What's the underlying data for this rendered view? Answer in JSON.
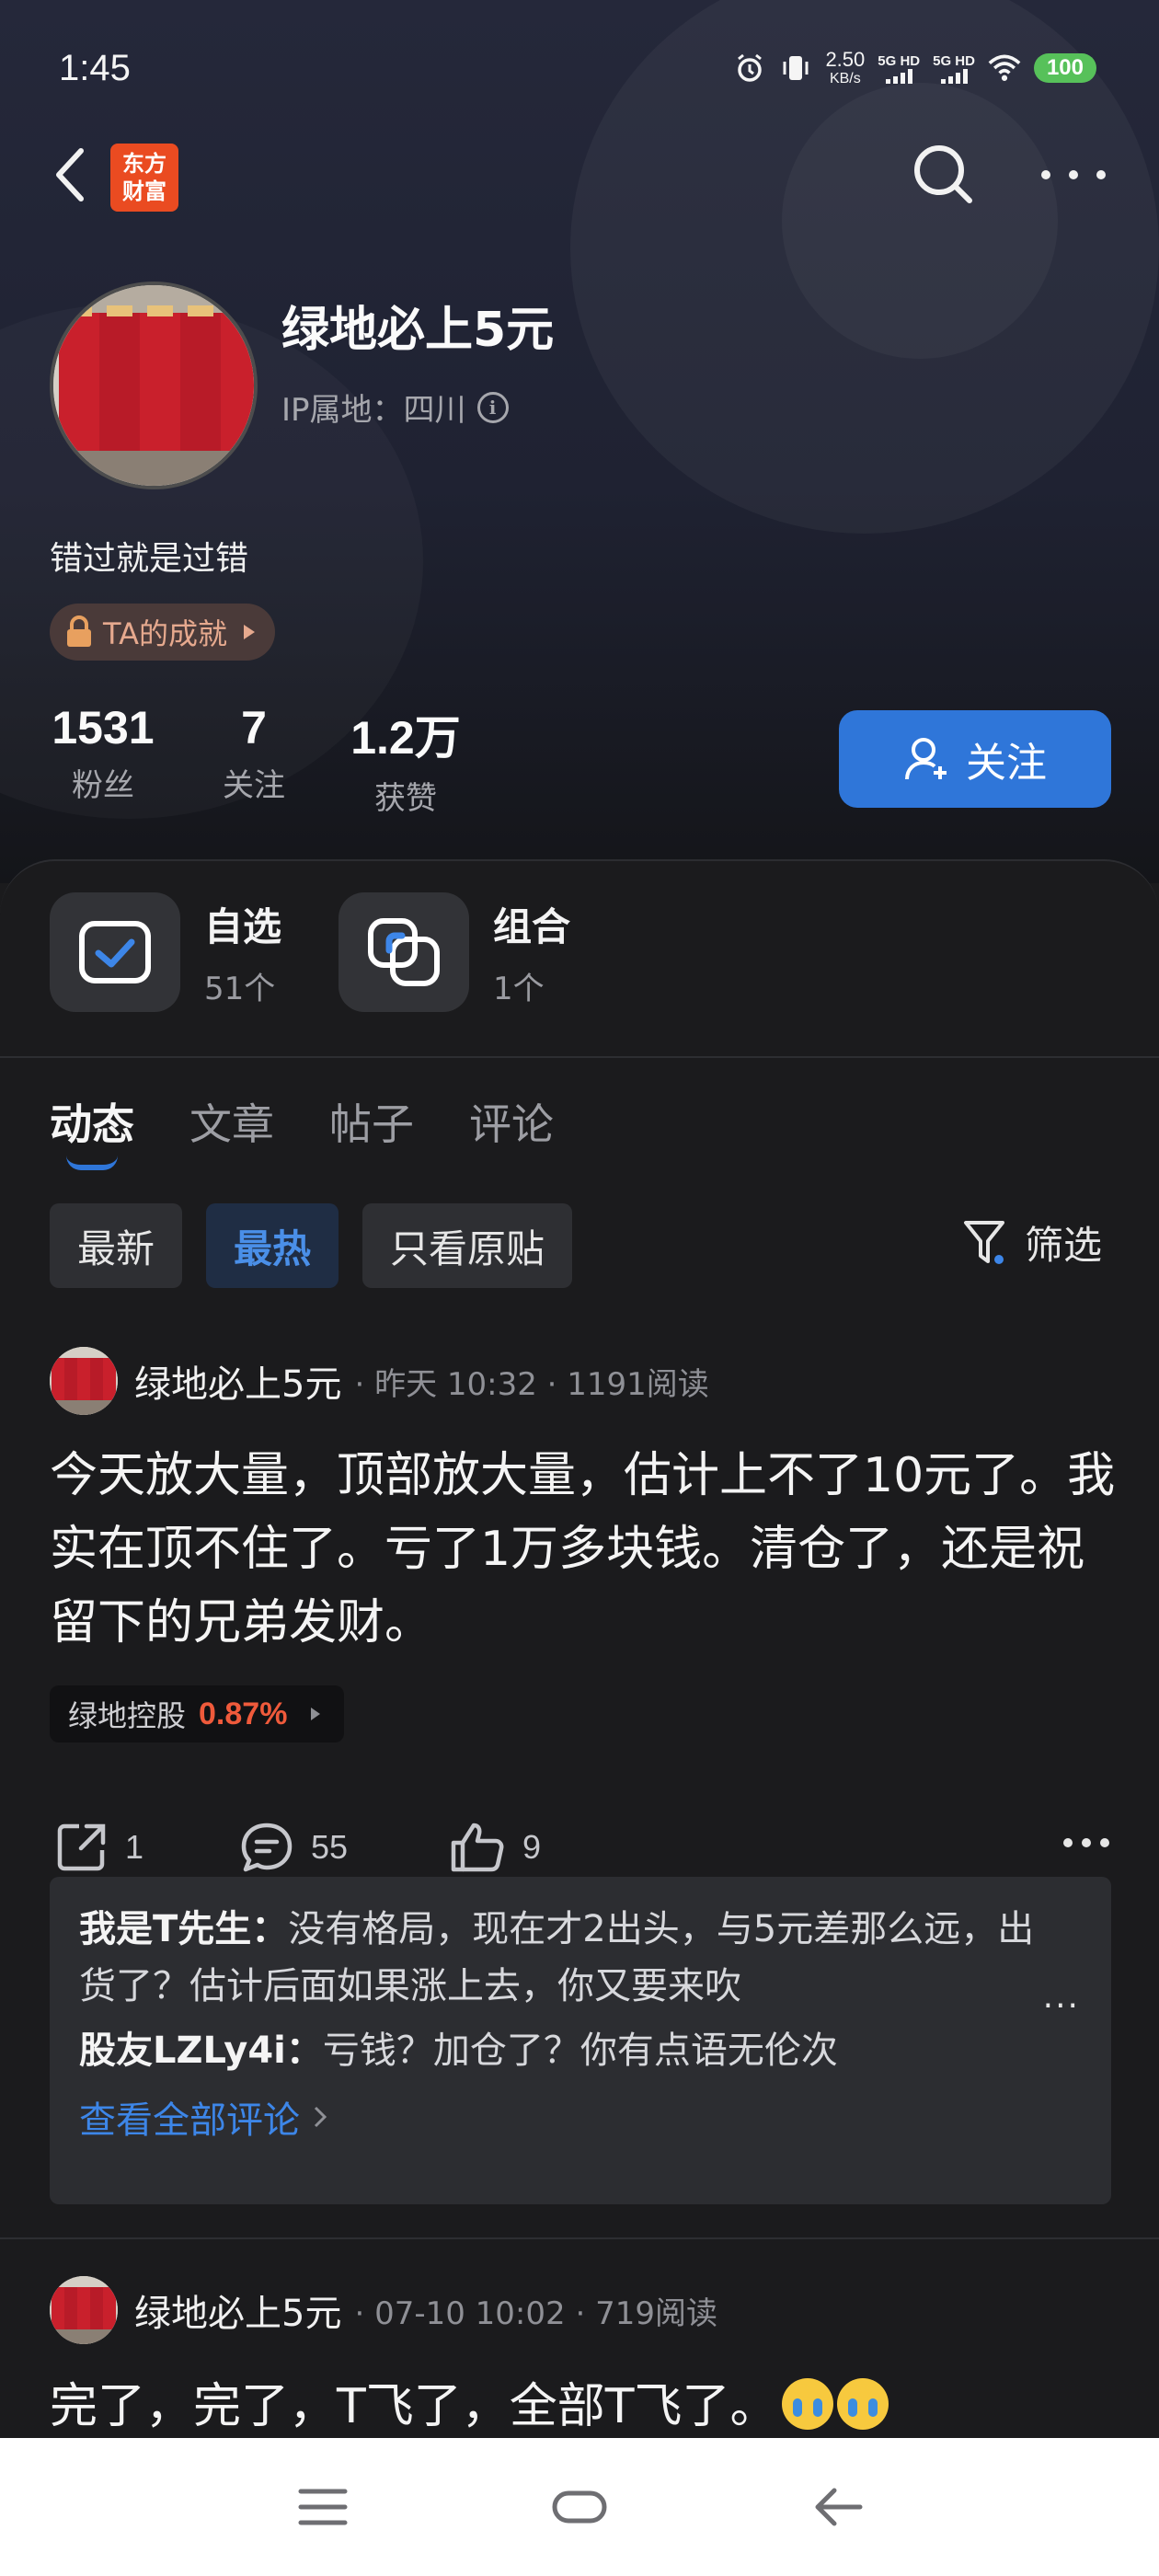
{
  "status_bar": {
    "time": "1:45",
    "net_speed_value": "2.50",
    "net_speed_unit": "KB/s",
    "sim1_label": "5G HD",
    "sim2_label": "5G HD",
    "battery": "100"
  },
  "app": {
    "logo_text_1": "东方",
    "logo_text_2": "财富"
  },
  "profile": {
    "name": "绿地必上5元",
    "ip_location": "IP属地：四川",
    "bio": "错过就是过错",
    "achievement": "TA的成就",
    "stats": [
      {
        "value": "1531",
        "label": "粉丝"
      },
      {
        "value": "7",
        "label": "关注"
      },
      {
        "value": "1.2万",
        "label": "获赞"
      }
    ],
    "follow_label": "关注"
  },
  "quick_links": [
    {
      "title": "自选",
      "sub": "51个"
    },
    {
      "title": "组合",
      "sub": "1个"
    }
  ],
  "tabs": [
    "动态",
    "文章",
    "帖子",
    "评论"
  ],
  "filters": [
    "最新",
    "最热",
    "只看原贴"
  ],
  "filter_button": "筛选",
  "posts": [
    {
      "author": "绿地必上5元",
      "meta": "· 昨天 10:32 · 1191阅读",
      "text": "今天放大量，顶部放大量，估计上不了10元了。我实在顶不住了。亏了1万多块钱。清仓了，还是祝留下的兄弟发财。",
      "stock_name": "绿地控股",
      "stock_change": "0.87%",
      "shares": "1",
      "comments": "55",
      "likes": "9",
      "comment_list": [
        {
          "user": "我是T先生：",
          "text": "没有格局，现在才2出头，与5元差那么远，出货了？估计后面如果涨上去，你又要来吹"
        },
        {
          "user": "股友LZLy4i：",
          "text": "亏钱？加仓了？你有点语无伦次"
        }
      ],
      "view_all": "查看全部评论"
    },
    {
      "author": "绿地必上5元",
      "meta": "· 07-10 10:02 · 719阅读",
      "text": "完了，完了，T飞了，全部T飞了。"
    }
  ]
}
